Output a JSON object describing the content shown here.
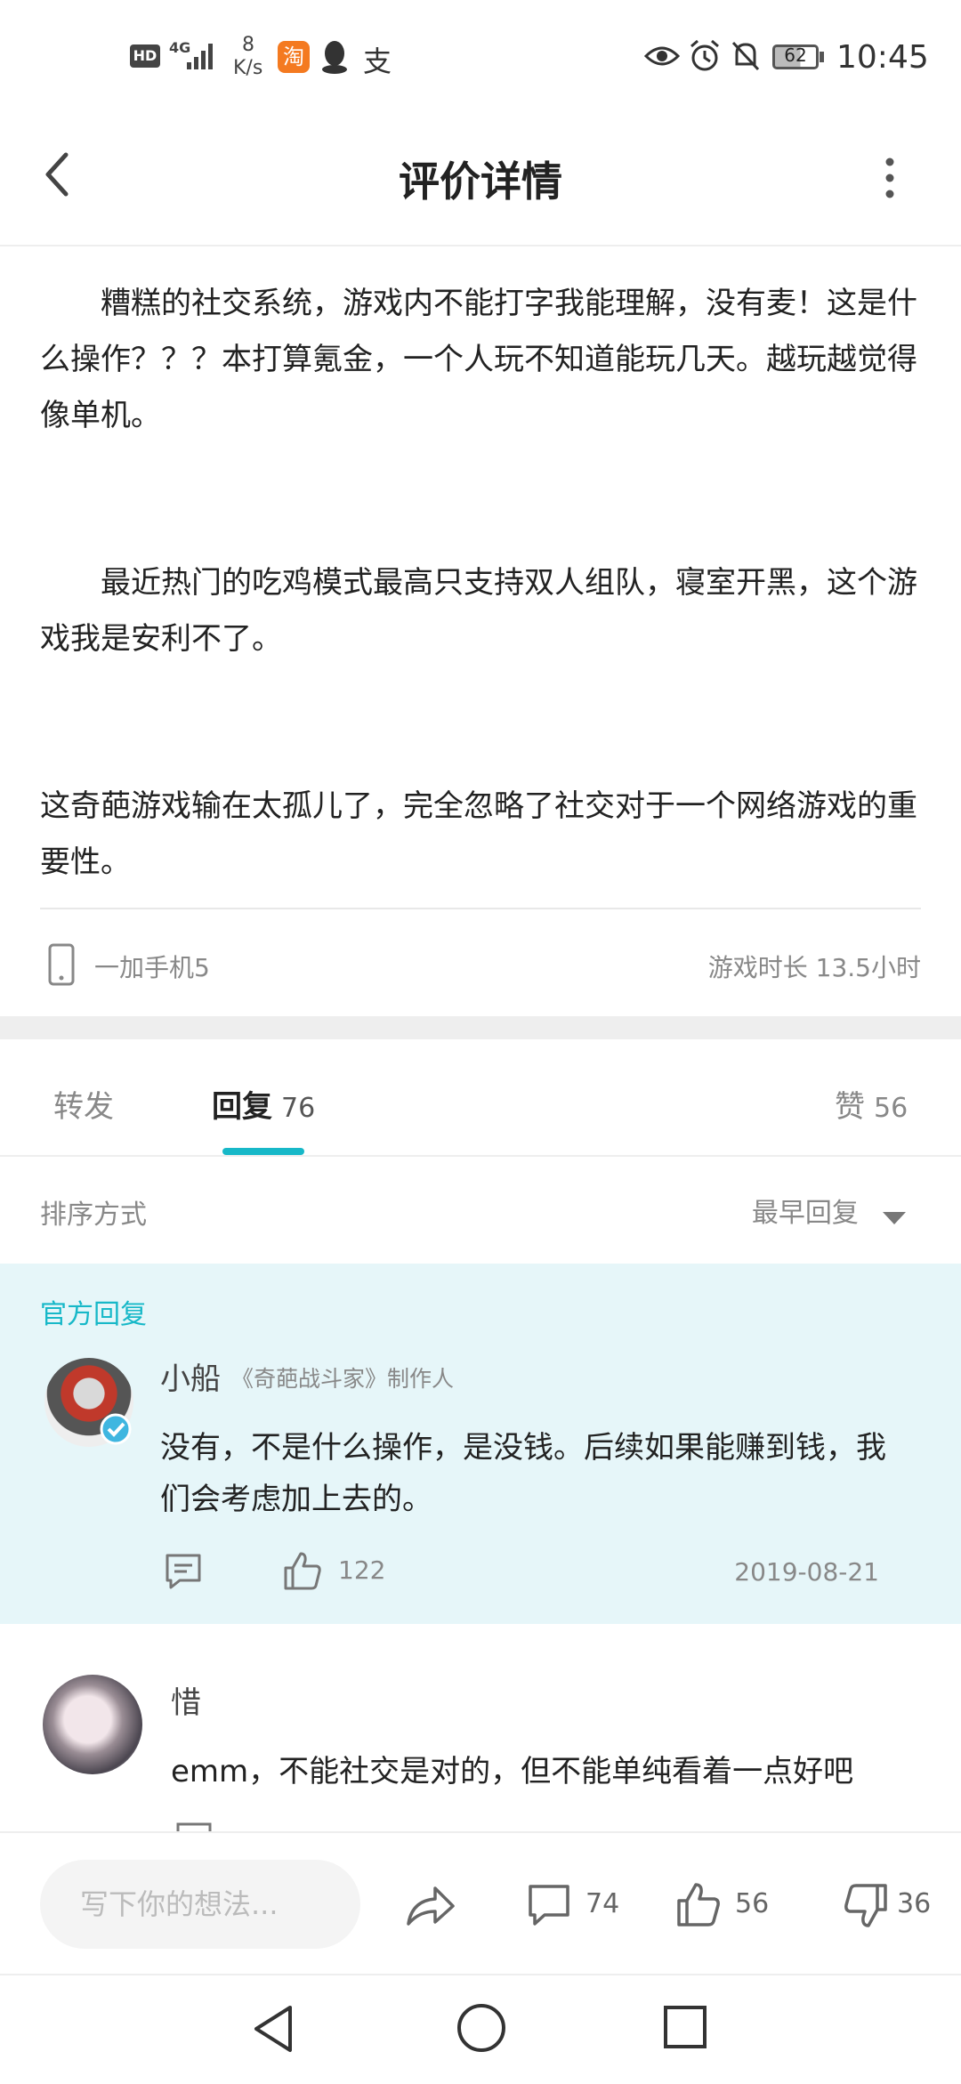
{
  "status_bar": {
    "hd": "HD",
    "net": "4G",
    "speed_value": "8",
    "speed_unit": "K/s",
    "taobao_glyph": "淘",
    "alipay_glyph": "支",
    "battery": "62",
    "time": "10:45"
  },
  "header": {
    "title": "评价详情"
  },
  "review": {
    "paragraphs": [
      "糟糕的社交系统，游戏内不能打字我能理解，没有麦！这是什么操作？？？本打算氪金，一个人玩不知道能玩几天。越玩越觉得像单机。",
      "最近热门的吃鸡模式最高只支持双人组队，寝室开黑，这个游戏我是安利不了。",
      "这奇葩游戏输在太孤儿了，完全忽略了社交对于一个网络游戏的重要性。"
    ],
    "device": "一加手机5",
    "play_time": "游戏时长 13.5小时"
  },
  "tabs": {
    "forward": "转发",
    "reply": "回复",
    "reply_count": "76",
    "like": "赞",
    "like_count": "56"
  },
  "sort": {
    "label": "排序方式",
    "value": "最早回复"
  },
  "official_reply": {
    "tag": "官方回复",
    "name": "小船",
    "title": "《奇葩战斗家》制作人",
    "body": "没有，不是什么操作，是没钱。后续如果能赚到钱，我们会考虑加上去的。",
    "likes": "122",
    "date": "2019-08-21"
  },
  "reply2": {
    "name": "惜",
    "body": "emm，不能社交是对的，但不能单纯看着一点好吧"
  },
  "bottom_bar": {
    "placeholder": "写下你的想法...",
    "comments": "74",
    "likes": "56",
    "dislikes": "36"
  },
  "colors": {
    "accent": "#17b8c8",
    "official_bg": "#e6f6f9"
  }
}
